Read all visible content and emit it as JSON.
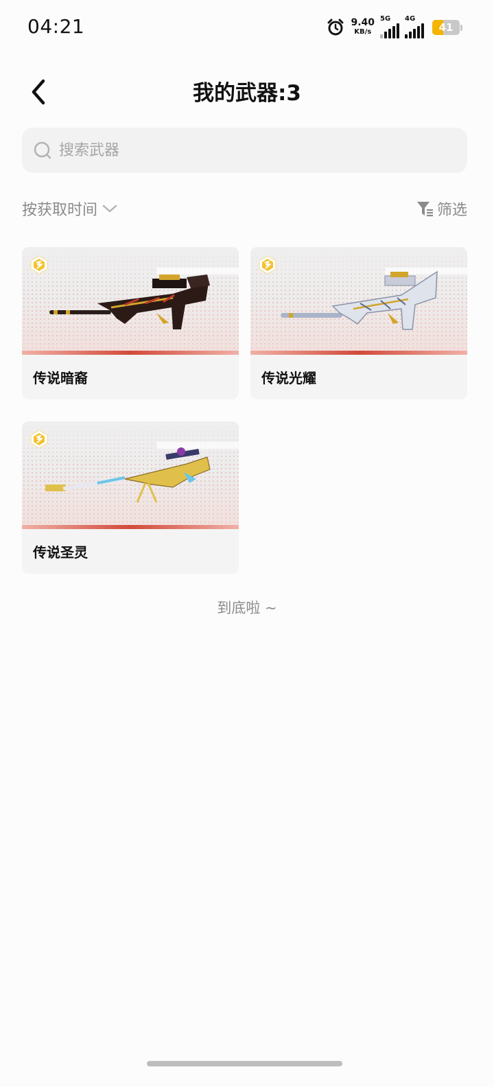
{
  "status_bar": {
    "time": "04:21",
    "net_speed_value": "9.40",
    "net_speed_unit": "KB/s",
    "signal_1": "5G",
    "signal_2": "4G",
    "battery": "41",
    "battery_level_percent": 41,
    "battery_color": "#f5b400"
  },
  "header": {
    "title": "我的武器:3",
    "back_icon": "chevron-left-icon"
  },
  "search": {
    "placeholder": "搜索武器",
    "value": "",
    "icon": "search-icon"
  },
  "sort": {
    "label": "按获取时间",
    "icon": "chevron-down-icon"
  },
  "filter": {
    "label": "筛选",
    "icon": "filter-icon"
  },
  "weapons": [
    {
      "name": "传说暗裔",
      "badge_icon": "legendary-badge-icon",
      "accent": "#d2a52a"
    },
    {
      "name": "传说光耀",
      "badge_icon": "legendary-badge-icon",
      "accent": "#c8d0e0"
    },
    {
      "name": "传说圣灵",
      "badge_icon": "legendary-badge-icon",
      "accent": "#e0c04a"
    }
  ],
  "footer": {
    "end_text": "到底啦 ~"
  },
  "colors": {
    "rarity_stripe": "#d24a3a",
    "badge_gold": "#f2c230"
  }
}
